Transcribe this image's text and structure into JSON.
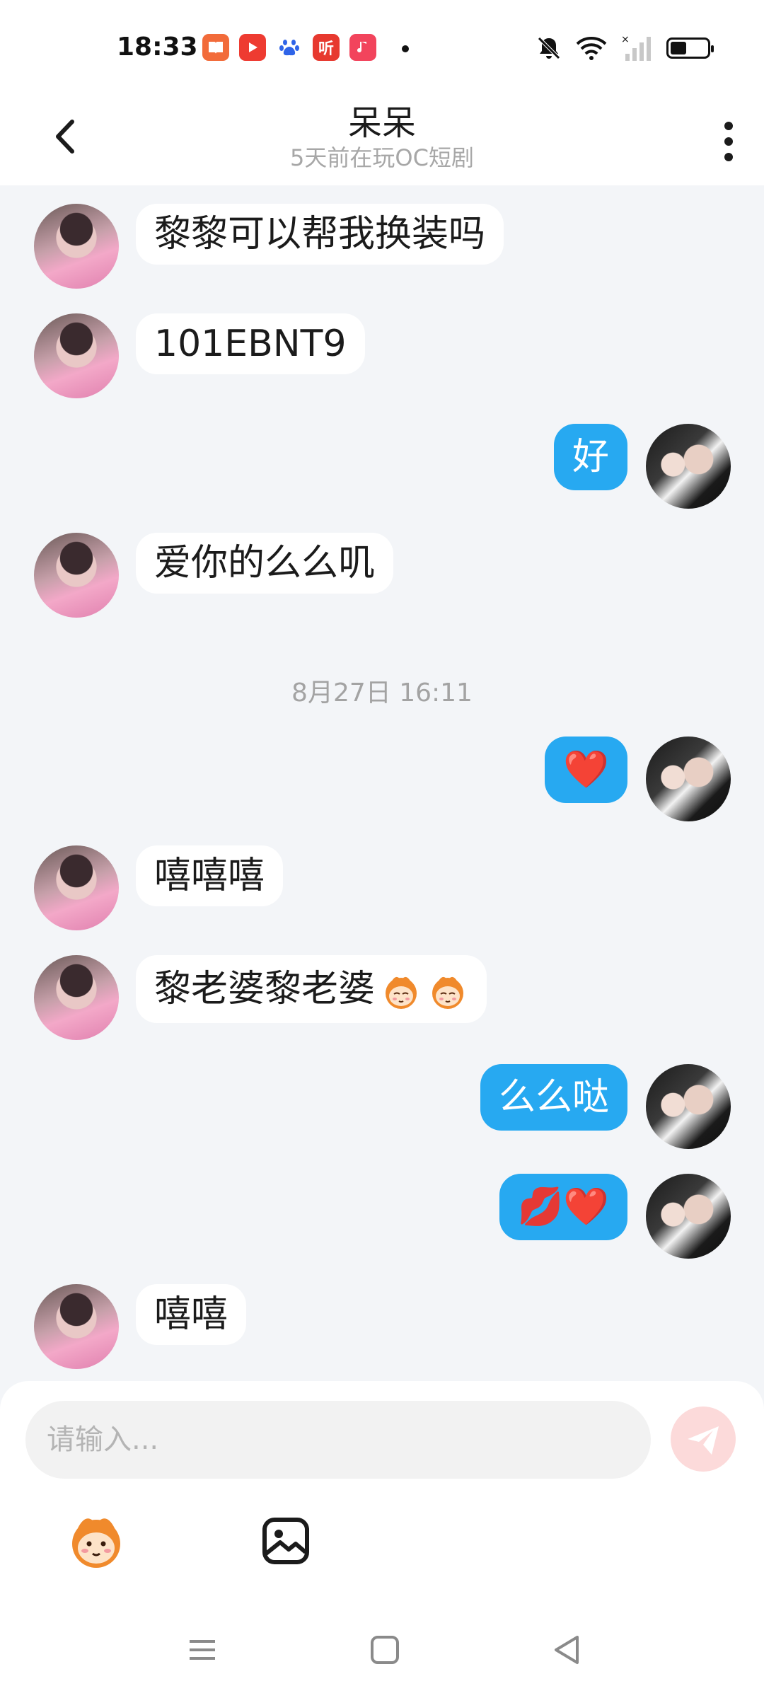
{
  "status_bar": {
    "time": "18:33",
    "notification_icons": [
      "book-app-icon",
      "video-app-icon",
      "baidu-paw-icon",
      "listen-app-icon",
      "music-app-icon"
    ],
    "listen_label": "听",
    "system_icons": [
      "mute-icon",
      "wifi-icon",
      "signal-icon",
      "battery-icon"
    ]
  },
  "header": {
    "title": "呆呆",
    "subtitle": "5天前在玩OC短剧"
  },
  "messages": [
    {
      "side": "in",
      "text": "黎黎可以帮我换装吗"
    },
    {
      "side": "in",
      "text": "101EBNT9"
    },
    {
      "side": "out",
      "text": "好"
    },
    {
      "side": "in",
      "text": "爱你的么么叽"
    },
    {
      "side": "in",
      "text": "嘻嘻嘻"
    },
    {
      "side": "in",
      "text": "黎老婆黎老婆"
    },
    {
      "side": "out",
      "text": "么么哒"
    },
    {
      "side": "out",
      "text": "💋❤️"
    },
    {
      "side": "in",
      "text": "嘻嘻"
    },
    {
      "side": "out",
      "text": "❤️"
    }
  ],
  "timestamp": "8月27日 16:11",
  "composer": {
    "placeholder": "请输入..."
  },
  "colors": {
    "chat_background": "#f3f5f8",
    "outgoing_bubble": "#27a9f1",
    "incoming_bubble": "#ffffff",
    "send_button": "#fcdada"
  }
}
